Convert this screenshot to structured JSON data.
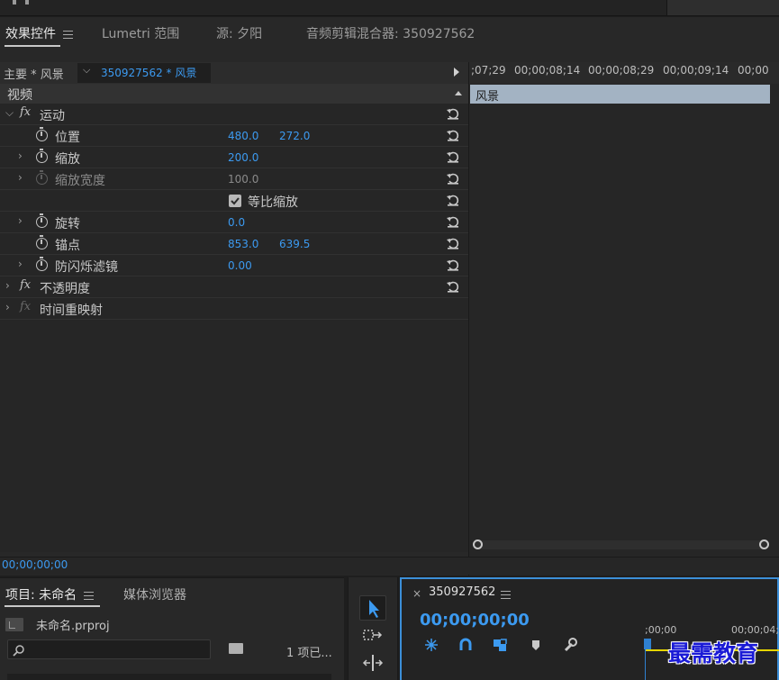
{
  "tabs": {
    "effect_controls": "效果控件",
    "lumetri_scopes": "Lumetri 范围",
    "source": "源: 夕阳",
    "audio_mixer": "音频剪辑混合器: 350927562"
  },
  "sequence_bar": {
    "master": "主要 * 风景",
    "selected_clip": "350927562 * 风景"
  },
  "effects": {
    "section_label": "视频",
    "motion": "运动",
    "position": {
      "label": "位置",
      "x": "480.0",
      "y": "272.0"
    },
    "scale": {
      "label": "缩放",
      "value": "200.0"
    },
    "scale_width": {
      "label": "缩放宽度",
      "value": "100.0"
    },
    "uniform_scale": {
      "label": "等比缩放",
      "checked": true
    },
    "rotation": {
      "label": "旋转",
      "value": "0.0"
    },
    "anchor_point": {
      "label": "锚点",
      "x": "853.0",
      "y": "639.5"
    },
    "anti_flicker": {
      "label": "防闪烁滤镜",
      "value": "0.00"
    },
    "opacity": "不透明度",
    "time_remap": "时间重映射"
  },
  "timeline": {
    "ticks": [
      ";07;29",
      "00;00;08;14",
      "00;00;08;29",
      "00;00;09;14",
      "00;00"
    ],
    "clip_name": "风景"
  },
  "bottom_timecode": "00;00;00;00",
  "project": {
    "tab": "项目: 未命名",
    "media_browser": "媒体浏览器",
    "file_name": "未命名.prproj",
    "item_count": "1 项已..."
  },
  "sequence": {
    "name": "350927562",
    "timecode": "00;00;00;00",
    "ruler": [
      ";00;00",
      "00;00;04;"
    ]
  },
  "watermark": "最需教育",
  "colors": {
    "accent_blue": "#3c9af0",
    "clip_blue_grey": "#a3b3c3",
    "panel_focus_border": "#3c8fd8",
    "work_area_yellow": "#e6d600"
  },
  "icons": [
    "menu-icon",
    "stopwatch-icon",
    "reset-icon",
    "fx-icon",
    "twirl-icon",
    "checkmark-icon",
    "search-icon",
    "new-bin-icon",
    "selection-tool-icon",
    "track-select-tool-icon",
    "ripple-edit-tool-icon",
    "insert-icon",
    "snap-icon",
    "linked-selection-icon",
    "add-marker-icon",
    "wrench-icon",
    "play-icon",
    "export-icon"
  ]
}
